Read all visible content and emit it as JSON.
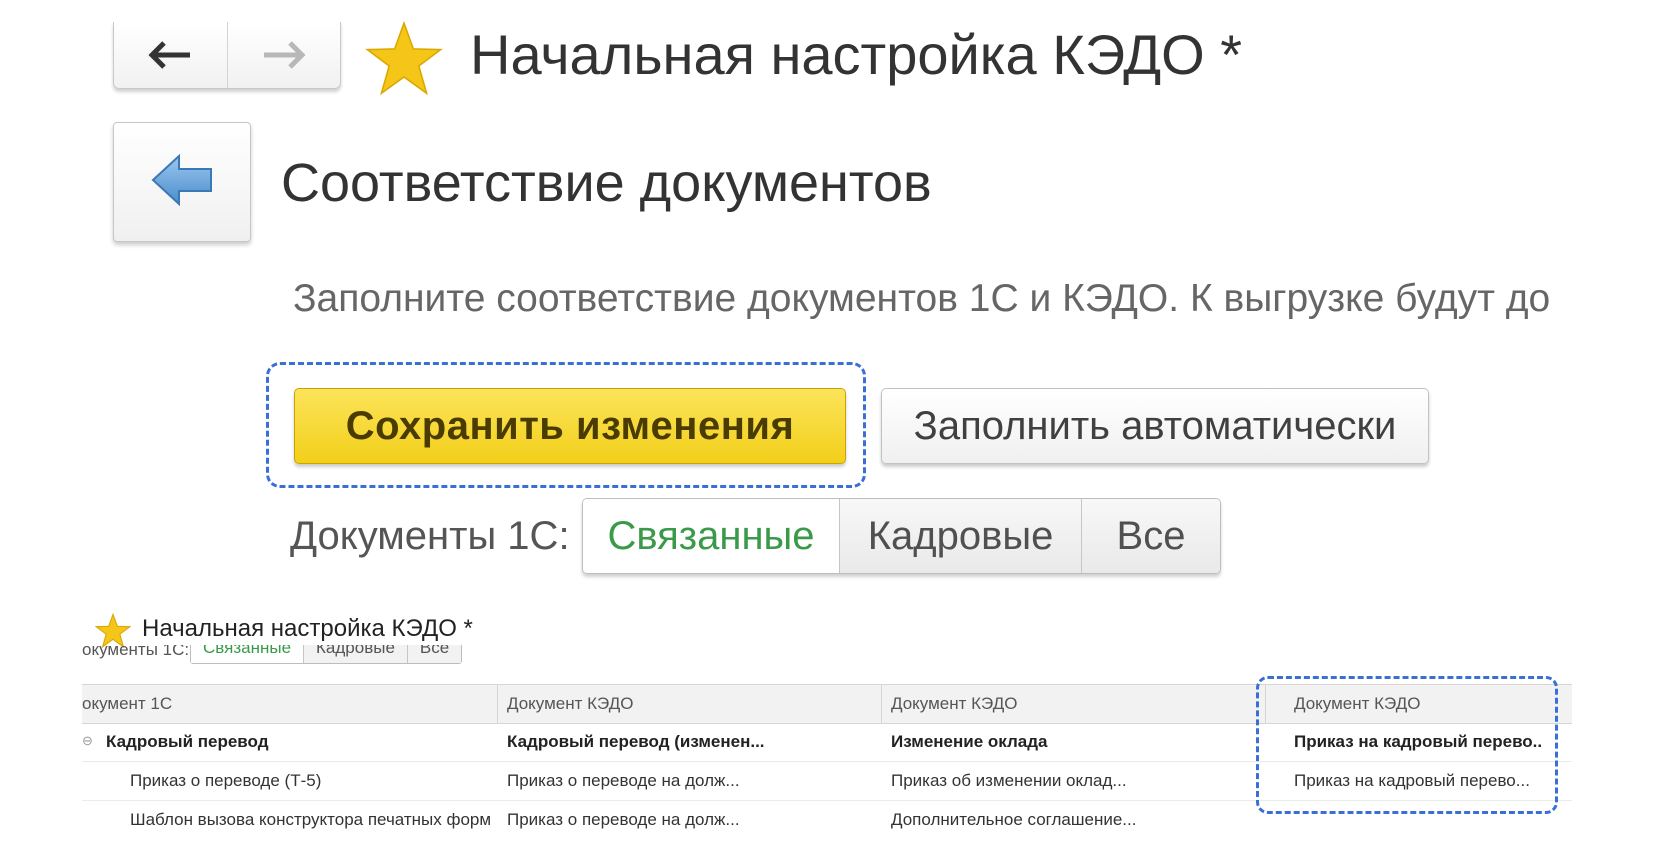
{
  "window": {
    "title": "Начальная настройка КЭДО *",
    "nav_back_icon": "arrow-left-icon",
    "nav_forward_icon": "arrow-right-icon",
    "favorite_icon": "star-icon",
    "star_color": "#f5c518"
  },
  "section": {
    "title": "Соответствие документов",
    "back_icon": "back-arrow-icon",
    "hint": "Заполните соответствие документов 1С и КЭДО. К выгрузке будут до"
  },
  "actions": {
    "save_label": "Сохранить изменения",
    "auto_fill_label": "Заполнить автоматически",
    "save_color": "#f7d52a"
  },
  "filter": {
    "label": "Документы 1С:",
    "options": [
      "Связанные",
      "Кадровые",
      "Все"
    ],
    "selected": "Связанные",
    "selected_color": "#3a9a4a"
  },
  "small_view": {
    "title": "Начальная настройка КЭДО *",
    "filter_label": "окументы 1С:",
    "options": [
      "Связанные",
      "Кадровые",
      "Все"
    ],
    "table": {
      "headers": [
        "окумент 1С",
        "Документ КЭДО",
        "Документ КЭДО",
        "Документ КЭДО"
      ],
      "rows": [
        {
          "cells": [
            "Кадровый перевод",
            "Кадровый перевод (изменен...",
            "Изменение оклада",
            "Приказ на кадровый перево.."
          ],
          "group": true,
          "expander": "⊖"
        },
        {
          "cells": [
            "Приказ о переводе (Т-5)",
            "Приказ о переводе на долж...",
            "Приказ об изменении оклад...",
            "Приказ на кадровый перево..."
          ],
          "group": false
        },
        {
          "cells": [
            "Шаблон вызова конструктора печатных форм",
            "Приказ о переводе на долж...",
            "Дополнительное соглашение...",
            ""
          ],
          "group": false
        }
      ]
    }
  }
}
